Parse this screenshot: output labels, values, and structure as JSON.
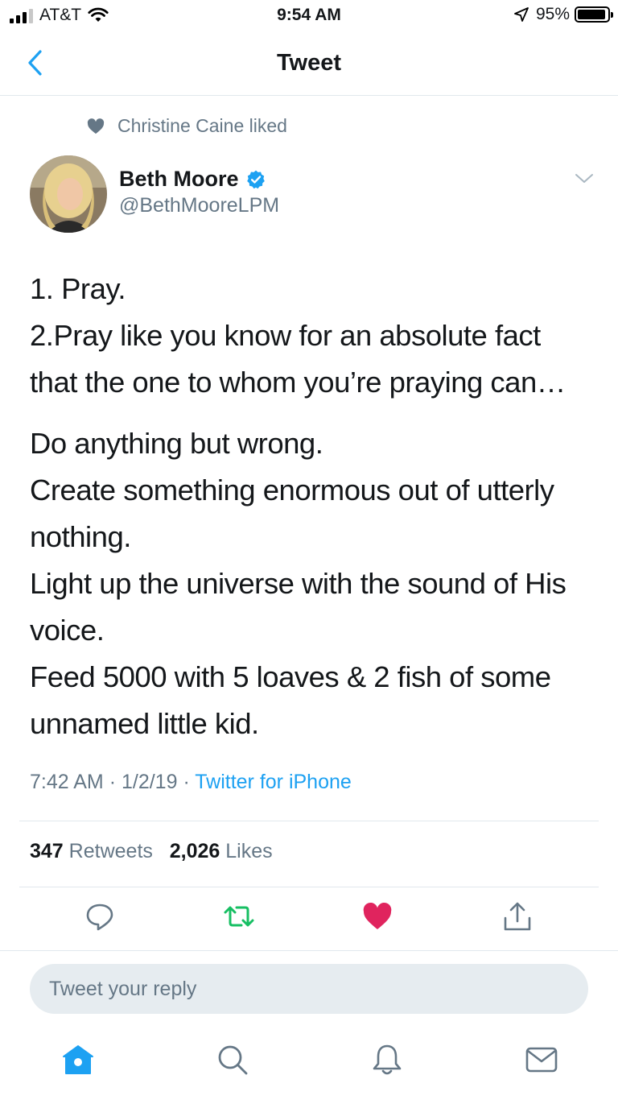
{
  "status_bar": {
    "carrier": "AT&T",
    "time": "9:54 AM",
    "battery": "95%",
    "battery_level": 0.95
  },
  "nav": {
    "title": "Tweet"
  },
  "social_context": {
    "text": "Christine Caine liked"
  },
  "author": {
    "name": "Beth Moore",
    "handle": "@BethMooreLPM",
    "verified": true
  },
  "tweet": {
    "lines": [
      "1. Pray.",
      "2.Pray like you know for an absolute fact that the one to whom you’re praying can…",
      "Do anything but wrong.",
      "Create something enormous out of utterly nothing.",
      "Light up the universe with the sound of His voice.",
      "Feed 5000 with 5 loaves & 2 fish of some unnamed little kid."
    ],
    "time": "7:42 AM",
    "date": "1/2/19",
    "separator": "·",
    "source": "Twitter for iPhone"
  },
  "stats": {
    "retweets_count": "347",
    "retweets_label": "Retweets",
    "likes_count": "2,026",
    "likes_label": "Likes"
  },
  "actions": [
    "reply",
    "retweet",
    "like",
    "share"
  ],
  "reply": {
    "placeholder": "Tweet your reply"
  },
  "tabs": [
    "home",
    "search",
    "notifications",
    "messages"
  ],
  "colors": {
    "blue": "#1da1f2",
    "green": "#17bf63",
    "red": "#e0245e",
    "gray": "#657786",
    "text": "#14171a"
  }
}
